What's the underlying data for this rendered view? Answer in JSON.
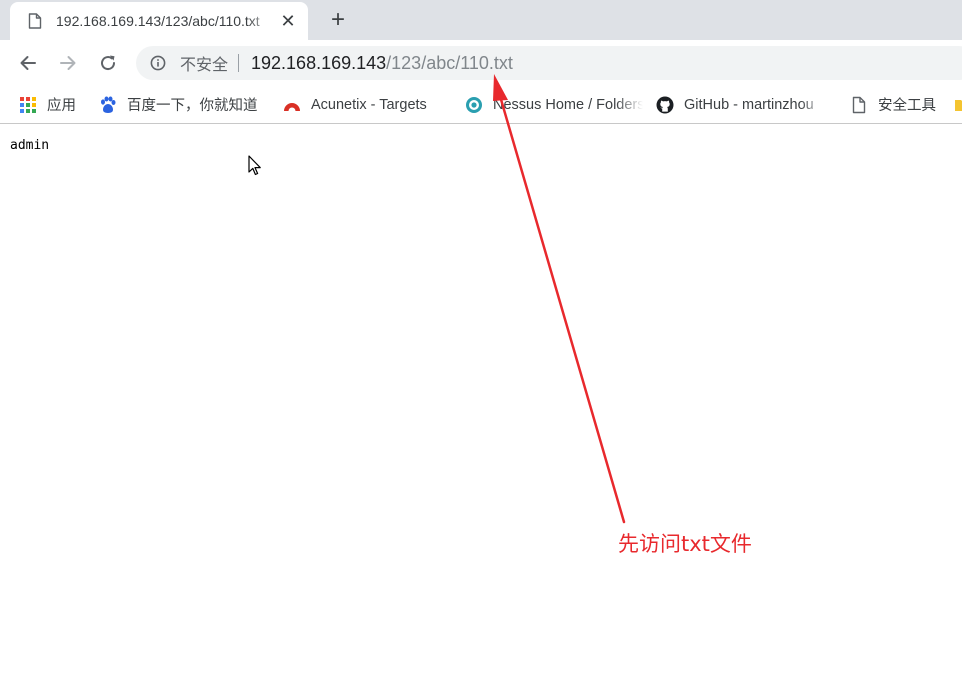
{
  "tab": {
    "title": "192.168.169.143/123/abc/110.txt",
    "close_glyph": "✕",
    "icon": "file-icon"
  },
  "new_tab_glyph": "+",
  "toolbar": {
    "back_icon": "arrow-left-icon",
    "forward_icon": "arrow-right-icon",
    "reload_icon": "reload-icon"
  },
  "omnibox": {
    "info_icon": "info-icon",
    "security_label": "不安全",
    "url_host": "192.168.169.143",
    "url_path": "/123/abc/110.txt"
  },
  "bookmarks": [
    {
      "label": "应用",
      "icon": "apps-grid-icon"
    },
    {
      "label": "百度一下，你就知道",
      "icon": "baidu-paw-icon"
    },
    {
      "label": "Acunetix - Targets",
      "icon": "acunetix-icon"
    },
    {
      "label": "Nessus Home / Folders",
      "icon": "nessus-icon"
    },
    {
      "label": "GitHub - martinzhou",
      "icon": "github-icon"
    },
    {
      "label": "安全工具",
      "icon": "file-icon"
    }
  ],
  "page": {
    "content": "admin"
  },
  "annotation": {
    "text": "先访问txt文件",
    "color": "#e8292d"
  },
  "colors": {
    "tabstrip": "#dee1e6",
    "omnibox": "#f1f3f4",
    "accent_red": "#e8292d"
  }
}
